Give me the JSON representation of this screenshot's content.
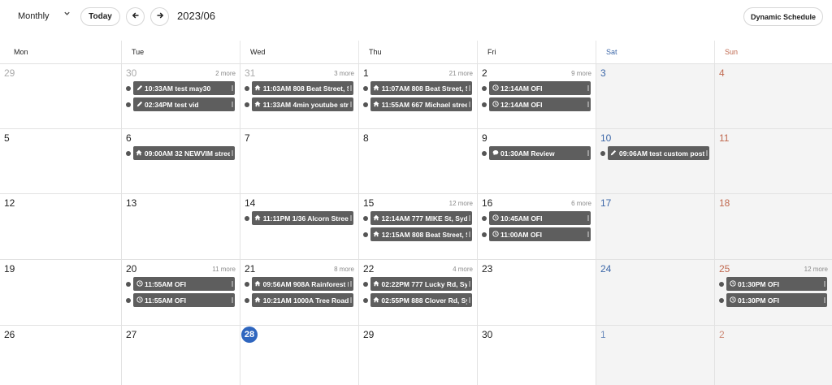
{
  "toolbar": {
    "view": "Monthly",
    "today_label": "Today",
    "title": "2023/06",
    "dynamic_label": "Dynamic Schedule"
  },
  "weekdays": [
    "Mon",
    "Tue",
    "Wed",
    "Thu",
    "Fri",
    "Sat",
    "Sun"
  ],
  "colors": {
    "accent": "#2f66bf",
    "event_bg": "#5e5e5e",
    "saturday": "#3c67a8",
    "sunday": "#c0694f"
  },
  "weeks": [
    [
      {
        "day": "29",
        "muted": true,
        "more": "",
        "events": []
      },
      {
        "day": "30",
        "muted": true,
        "more": "2 more",
        "events": [
          {
            "icon": "pencil-icon",
            "text": "10:33AM test may30"
          },
          {
            "icon": "pencil-icon",
            "text": "02:34PM test vid"
          }
        ]
      },
      {
        "day": "31",
        "muted": true,
        "more": "3 more",
        "events": [
          {
            "icon": "home-icon",
            "text": "11:03AM 808 Beat Street, S"
          },
          {
            "icon": "home-icon",
            "text": "11:33AM 4min youtube stre"
          }
        ]
      },
      {
        "day": "1",
        "muted": false,
        "more": "21 more",
        "events": [
          {
            "icon": "home-icon",
            "text": "11:07AM 808 Beat Street, S"
          },
          {
            "icon": "home-icon",
            "text": "11:55AM 667 Michael street"
          }
        ]
      },
      {
        "day": "2",
        "muted": false,
        "more": "9 more",
        "events": [
          {
            "icon": "clock-icon",
            "text": "12:14AM OFI"
          },
          {
            "icon": "clock-icon",
            "text": "12:14AM OFI"
          }
        ]
      },
      {
        "day": "3",
        "muted": false,
        "more": "",
        "events": []
      },
      {
        "day": "4",
        "muted": false,
        "more": "",
        "events": []
      }
    ],
    [
      {
        "day": "5",
        "muted": false,
        "more": "",
        "events": []
      },
      {
        "day": "6",
        "muted": false,
        "more": "",
        "events": [
          {
            "icon": "home-icon",
            "text": "09:00AM 32 NEWVIM stree"
          }
        ]
      },
      {
        "day": "7",
        "muted": false,
        "more": "",
        "events": []
      },
      {
        "day": "8",
        "muted": false,
        "more": "",
        "events": []
      },
      {
        "day": "9",
        "muted": false,
        "more": "",
        "events": [
          {
            "icon": "comment-icon",
            "text": "01:30AM Review"
          }
        ]
      },
      {
        "day": "10",
        "muted": false,
        "more": "",
        "events": [
          {
            "icon": "pencil-icon",
            "text": "09:06AM test custom post"
          }
        ]
      },
      {
        "day": "11",
        "muted": false,
        "more": "",
        "events": []
      }
    ],
    [
      {
        "day": "12",
        "muted": false,
        "more": "",
        "events": []
      },
      {
        "day": "13",
        "muted": false,
        "more": "",
        "events": []
      },
      {
        "day": "14",
        "muted": false,
        "more": "",
        "events": [
          {
            "icon": "home-icon",
            "text": "11:11PM 1/36 Alcorn Street"
          }
        ]
      },
      {
        "day": "15",
        "muted": false,
        "more": "12 more",
        "events": [
          {
            "icon": "home-icon",
            "text": "12:14AM 777 MIKE St, Sydn"
          },
          {
            "icon": "home-icon",
            "text": "12:15AM 808 Beat Street, S"
          }
        ]
      },
      {
        "day": "16",
        "muted": false,
        "more": "6 more",
        "events": [
          {
            "icon": "clock-icon",
            "text": "10:45AM OFI"
          },
          {
            "icon": "clock-icon",
            "text": "11:00AM OFI"
          }
        ]
      },
      {
        "day": "17",
        "muted": false,
        "more": "",
        "events": []
      },
      {
        "day": "18",
        "muted": false,
        "more": "",
        "events": []
      }
    ],
    [
      {
        "day": "19",
        "muted": false,
        "more": "",
        "events": []
      },
      {
        "day": "20",
        "muted": false,
        "more": "11 more",
        "events": [
          {
            "icon": "clock-icon",
            "text": "11:55AM OFI"
          },
          {
            "icon": "clock-icon",
            "text": "11:55AM OFI"
          }
        ]
      },
      {
        "day": "21",
        "muted": false,
        "more": "8 more",
        "events": [
          {
            "icon": "home-icon",
            "text": "09:56AM 908A Rainforest R"
          },
          {
            "icon": "home-icon",
            "text": "10:21AM 1000A Tree Road,"
          }
        ]
      },
      {
        "day": "22",
        "muted": false,
        "more": "4 more",
        "events": [
          {
            "icon": "home-icon",
            "text": "02:22PM 777 Lucky Rd, Syd"
          },
          {
            "icon": "home-icon",
            "text": "02:55PM 888 Clover Rd, Syc"
          }
        ]
      },
      {
        "day": "23",
        "muted": false,
        "more": "",
        "events": []
      },
      {
        "day": "24",
        "muted": false,
        "more": "",
        "events": []
      },
      {
        "day": "25",
        "muted": false,
        "more": "12 more",
        "events": [
          {
            "icon": "clock-icon",
            "text": "01:30PM OFI"
          },
          {
            "icon": "clock-icon",
            "text": "01:30PM OFI"
          }
        ]
      }
    ],
    [
      {
        "day": "26",
        "muted": false,
        "more": "",
        "events": []
      },
      {
        "day": "27",
        "muted": false,
        "more": "",
        "events": []
      },
      {
        "day": "28",
        "muted": false,
        "today": true,
        "more": "",
        "events": []
      },
      {
        "day": "29",
        "muted": false,
        "more": "",
        "events": []
      },
      {
        "day": "30",
        "muted": false,
        "more": "",
        "events": []
      },
      {
        "day": "1",
        "muted": true,
        "more": "",
        "events": []
      },
      {
        "day": "2",
        "muted": true,
        "more": "",
        "events": []
      }
    ]
  ]
}
